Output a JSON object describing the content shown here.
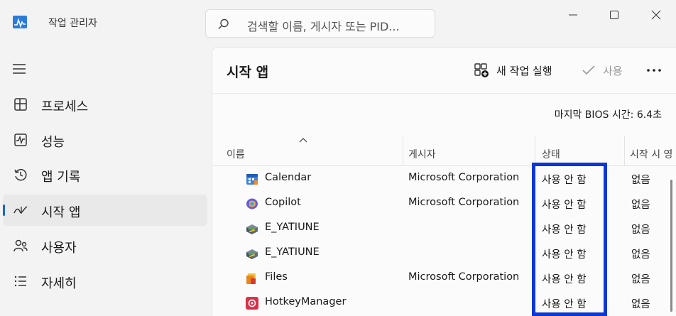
{
  "window": {
    "title": "작업 관리자",
    "search_placeholder": "검색할 이름, 게시자 또는 PID...",
    "icons": {
      "app": "task-manager-icon",
      "search": "search-icon",
      "minimize": "minimize-icon",
      "maximize": "maximize-icon",
      "close": "close-icon"
    }
  },
  "sidebar": {
    "menu_icon": "hamburger-icon",
    "items": [
      {
        "label": "프로세스",
        "icon": "processes-icon"
      },
      {
        "label": "성능",
        "icon": "performance-icon"
      },
      {
        "label": "앱 기록",
        "icon": "app-history-icon"
      },
      {
        "label": "시작 앱",
        "icon": "startup-apps-icon",
        "active": true
      },
      {
        "label": "사용자",
        "icon": "users-icon"
      },
      {
        "label": "자세히",
        "icon": "details-icon"
      }
    ]
  },
  "main": {
    "title": "시작 앱",
    "toolbar": {
      "new_task_label": "새 작업 실행",
      "enable_label": "사용",
      "more_icon": "more-icon"
    },
    "bios_label": "마지막 BIOS 시간:",
    "bios_value": "6.4초",
    "columns": {
      "name": "이름",
      "publisher": "게시자",
      "status": "상태",
      "startup_impact": "시작 시 영"
    },
    "rows": [
      {
        "name": "Calendar",
        "publisher": "Microsoft Corporation",
        "status": "사용 안 함",
        "impact": "없음",
        "icon": "calendar-app-icon"
      },
      {
        "name": "Copilot",
        "publisher": "Microsoft Corporation",
        "status": "사용 안 함",
        "impact": "없음",
        "icon": "copilot-icon"
      },
      {
        "name": "E_YATIUNE",
        "publisher": "",
        "status": "사용 안 함",
        "impact": "없음",
        "icon": "printer-utility-icon"
      },
      {
        "name": "E_YATIUNE",
        "publisher": "",
        "status": "사용 안 함",
        "impact": "없음",
        "icon": "printer-utility-icon"
      },
      {
        "name": "Files",
        "publisher": "Microsoft Corporation",
        "status": "사용 안 함",
        "impact": "없음",
        "icon": "files-app-icon"
      },
      {
        "name": "HotkeyManager",
        "publisher": "",
        "status": "사용 안 함",
        "impact": "없음",
        "icon": "hotkey-manager-icon"
      }
    ]
  },
  "colors": {
    "accent": "#1766c4",
    "highlight_box": "#0a37d6"
  }
}
